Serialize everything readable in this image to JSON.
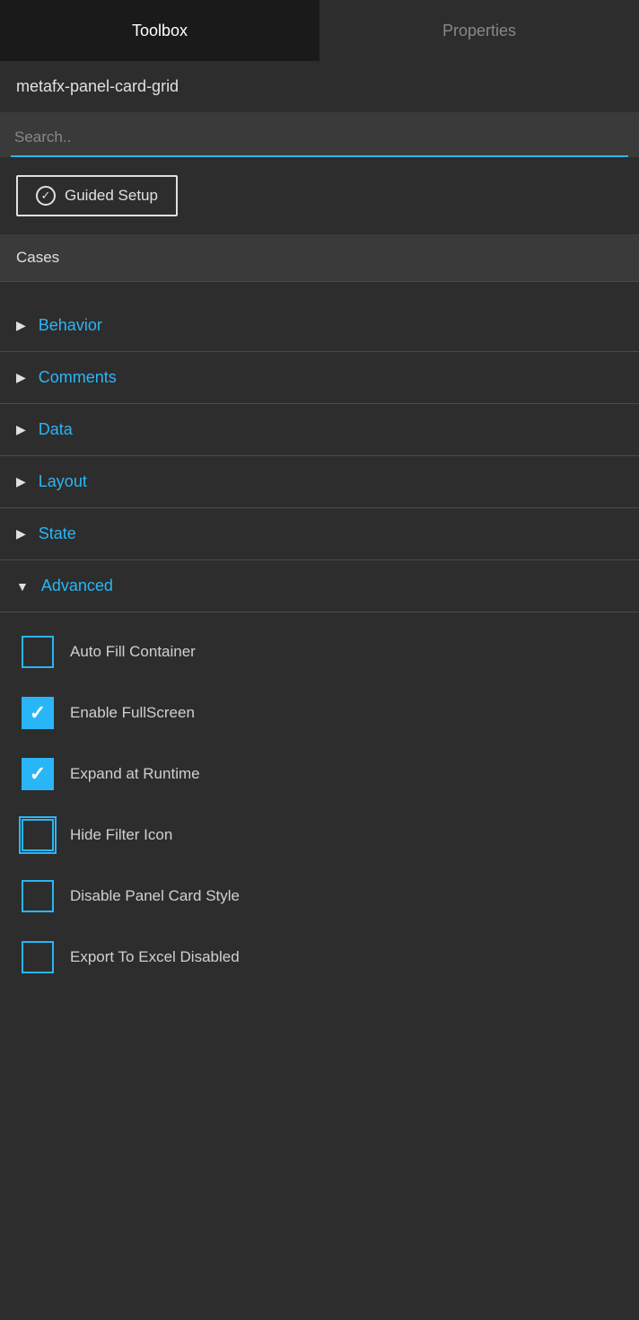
{
  "header": {
    "tabs": [
      {
        "id": "toolbox",
        "label": "Toolbox",
        "active": true
      },
      {
        "id": "properties",
        "label": "Properties",
        "active": false
      }
    ]
  },
  "component": {
    "name": "metafx-panel-card-grid"
  },
  "search": {
    "placeholder": "Search.."
  },
  "guided_setup": {
    "label": "Guided Setup"
  },
  "cases": {
    "label": "Cases"
  },
  "accordion": {
    "sections": [
      {
        "id": "behavior",
        "label": "Behavior",
        "expanded": false
      },
      {
        "id": "comments",
        "label": "Comments",
        "expanded": false
      },
      {
        "id": "data",
        "label": "Data",
        "expanded": false
      },
      {
        "id": "layout",
        "label": "Layout",
        "expanded": false
      },
      {
        "id": "state",
        "label": "State",
        "expanded": false
      }
    ]
  },
  "advanced": {
    "label": "Advanced",
    "expanded": true,
    "checkboxes": [
      {
        "id": "auto-fill-container",
        "label": "Auto Fill Container",
        "checked": false,
        "focused": false
      },
      {
        "id": "enable-fullscreen",
        "label": "Enable FullScreen",
        "checked": true,
        "focused": false
      },
      {
        "id": "expand-at-runtime",
        "label": "Expand at Runtime",
        "checked": true,
        "focused": false
      },
      {
        "id": "hide-filter-icon",
        "label": "Hide Filter Icon",
        "checked": false,
        "focused": true
      },
      {
        "id": "disable-panel-card-style",
        "label": "Disable Panel Card Style",
        "checked": false,
        "focused": false
      },
      {
        "id": "export-to-excel-disabled",
        "label": "Export To Excel Disabled",
        "checked": false,
        "focused": false
      }
    ]
  },
  "icons": {
    "chevron_right": "▶",
    "chevron_down": "▼",
    "check_circle": "✓"
  }
}
